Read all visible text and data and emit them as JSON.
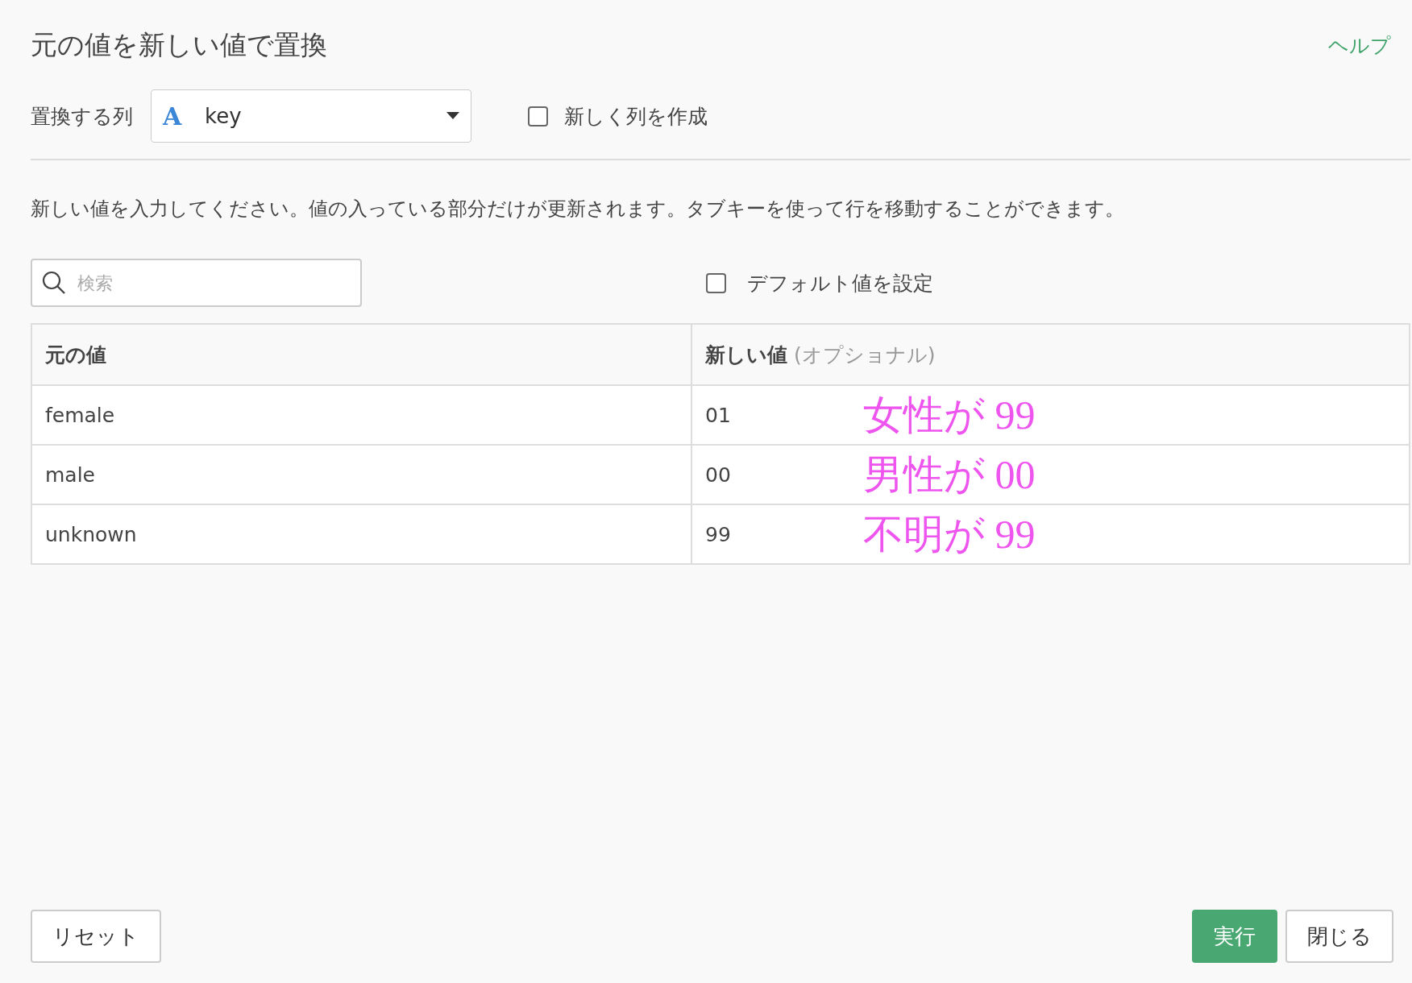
{
  "title": "元の値を新しい値で置換",
  "help_link": "ヘルプ",
  "column_select": {
    "label": "置換する列",
    "type_icon": "A",
    "value": "key"
  },
  "new_column": {
    "label": "新しく列を作成",
    "checked": false
  },
  "description": "新しい値を入力してください。値の入っている部分だけが更新されます。タブキーを使って行を移動することができます。",
  "search": {
    "placeholder": "検索"
  },
  "default_value": {
    "label": "デフォルト値を設定",
    "checked": false
  },
  "table": {
    "columns": [
      {
        "label": "元の値"
      },
      {
        "label": "新しい値",
        "note": "(オプショナル)"
      }
    ],
    "rows": [
      {
        "original": "female",
        "new_value": "01",
        "annotation": "女性が 99"
      },
      {
        "original": "male",
        "new_value": "00",
        "annotation": "男性が 00"
      },
      {
        "original": "unknown",
        "new_value": "99",
        "annotation": "不明が 99"
      }
    ]
  },
  "buttons": {
    "reset": "リセット",
    "run": "実行",
    "close": "閉じる"
  }
}
